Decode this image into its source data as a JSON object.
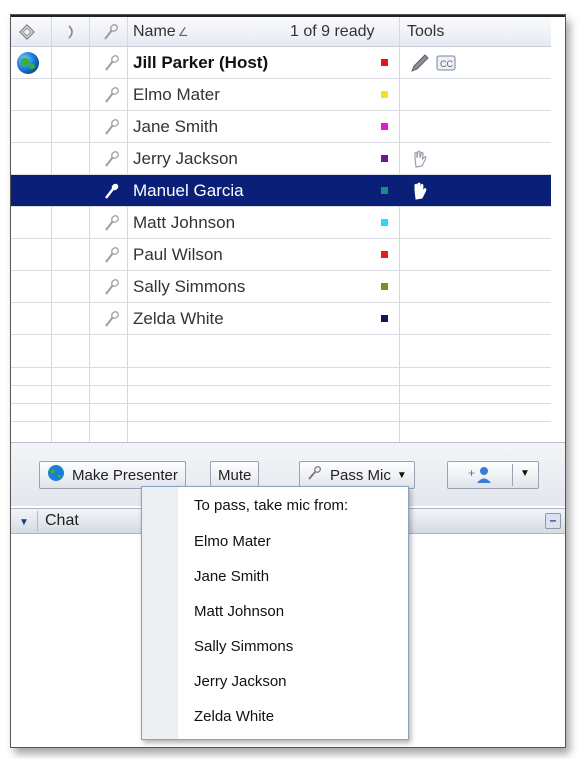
{
  "header": {
    "name_label": "Name",
    "sort_indicator": "∠",
    "ready_status": "1 of 9 ready",
    "tools_label": "Tools"
  },
  "participants": [
    {
      "name": "Jill Parker (Host)",
      "color": "#e8141a",
      "presenter": true,
      "bold": true,
      "tools": [
        "pencil-icon",
        "closed-caption-icon"
      ]
    },
    {
      "name": "Elmo Mater",
      "color": "#f2e21a",
      "tools": []
    },
    {
      "name": "Jane Smith",
      "color": "#e21ad8",
      "tools": []
    },
    {
      "name": "Jerry Jackson",
      "color": "#6a1a8a",
      "tools": [
        "hand-outline-icon"
      ]
    },
    {
      "name": "Manuel Garcia",
      "color": "#1a8a8a",
      "selected": true,
      "has_mic": true,
      "tools": [
        "hand-raised-icon"
      ]
    },
    {
      "name": "Matt Johnson",
      "color": "#2ad8f0",
      "tools": []
    },
    {
      "name": "Paul Wilson",
      "color": "#e81a1a",
      "tools": []
    },
    {
      "name": "Sally Simmons",
      "color": "#8a8a1a",
      "tools": []
    },
    {
      "name": "Zelda White",
      "color": "#0d1a5a",
      "tools": []
    }
  ],
  "toolbar": {
    "make_presenter_label": "Make Presenter",
    "mute_label": "Mute",
    "pass_mic_label": "Pass Mic",
    "add_user_label": "+"
  },
  "chat": {
    "title": "Chat",
    "minimize_label": "–"
  },
  "pass_mic_menu": {
    "heading": "To pass, take mic from:",
    "items": [
      "Elmo Mater",
      "Jane Smith",
      "Matt Johnson",
      "Sally Simmons",
      "Jerry Jackson",
      "Zelda White"
    ]
  }
}
